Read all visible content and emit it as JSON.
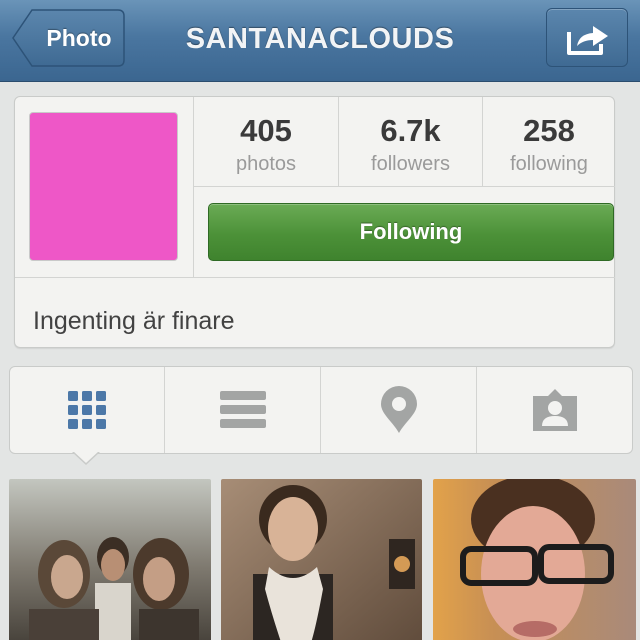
{
  "navbar": {
    "back_label": "Photo",
    "title": "SANTANACLOUDS",
    "share_icon": "share-icon",
    "bar_color": "#4a76a0"
  },
  "profile": {
    "avatar_color": "#ee57c7",
    "stats": [
      {
        "value": "405",
        "label": "photos"
      },
      {
        "value": "6.7k",
        "label": "followers"
      },
      {
        "value": "258",
        "label": "following"
      }
    ],
    "follow_button_label": "Following",
    "follow_button_color": "#4c9138",
    "bio": "Ingenting är finare"
  },
  "view_switcher": {
    "tabs": [
      {
        "icon": "grid-icon",
        "selected": true
      },
      {
        "icon": "list-icon",
        "selected": false
      },
      {
        "icon": "location-pin-icon",
        "selected": false
      },
      {
        "icon": "tagged-person-icon",
        "selected": false
      }
    ],
    "selected_color": "#4c78a8"
  },
  "photos": [
    {
      "subject": "group-selfie-photo"
    },
    {
      "subject": "boy-with-scarf-photo"
    },
    {
      "subject": "boy-with-glasses-photo"
    }
  ]
}
